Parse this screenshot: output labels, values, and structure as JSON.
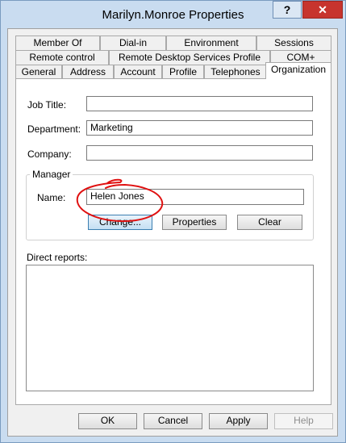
{
  "window": {
    "title": "Marilyn.Monroe Properties",
    "help_label": "?",
    "close_label": "✕"
  },
  "tabs": {
    "row1": [
      "Member Of",
      "Dial-in",
      "Environment",
      "Sessions"
    ],
    "row2": [
      "Remote control",
      "Remote Desktop Services Profile",
      "COM+"
    ],
    "row3": [
      "General",
      "Address",
      "Account",
      "Profile",
      "Telephones",
      "Organization"
    ],
    "selected": "Organization"
  },
  "organization": {
    "job_title_label": "Job Title:",
    "job_title_value": "",
    "department_label": "Department:",
    "department_value": "Marketing",
    "company_label": "Company:",
    "company_value": "",
    "manager": {
      "group_label": "Manager",
      "name_label": "Name:",
      "name_value": "Helen Jones",
      "change_label": "Change...",
      "properties_label": "Properties",
      "clear_label": "Clear"
    },
    "direct_reports_label": "Direct reports:"
  },
  "footer": {
    "ok_label": "OK",
    "cancel_label": "Cancel",
    "apply_label": "Apply",
    "help_label": "Help"
  },
  "colors": {
    "title_bar": "#c9dcf0",
    "close_button": "#c7342e",
    "annotation_ink": "#e01010"
  }
}
